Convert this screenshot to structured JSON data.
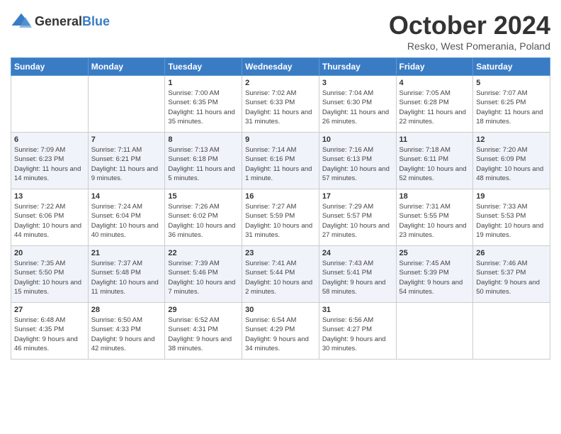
{
  "logo": {
    "general": "General",
    "blue": "Blue"
  },
  "title": "October 2024",
  "location": "Resko, West Pomerania, Poland",
  "weekdays": [
    "Sunday",
    "Monday",
    "Tuesday",
    "Wednesday",
    "Thursday",
    "Friday",
    "Saturday"
  ],
  "weeks": [
    [
      {
        "day": "",
        "sunrise": "",
        "sunset": "",
        "daylight": ""
      },
      {
        "day": "",
        "sunrise": "",
        "sunset": "",
        "daylight": ""
      },
      {
        "day": "1",
        "sunrise": "Sunrise: 7:00 AM",
        "sunset": "Sunset: 6:35 PM",
        "daylight": "Daylight: 11 hours and 35 minutes."
      },
      {
        "day": "2",
        "sunrise": "Sunrise: 7:02 AM",
        "sunset": "Sunset: 6:33 PM",
        "daylight": "Daylight: 11 hours and 31 minutes."
      },
      {
        "day": "3",
        "sunrise": "Sunrise: 7:04 AM",
        "sunset": "Sunset: 6:30 PM",
        "daylight": "Daylight: 11 hours and 26 minutes."
      },
      {
        "day": "4",
        "sunrise": "Sunrise: 7:05 AM",
        "sunset": "Sunset: 6:28 PM",
        "daylight": "Daylight: 11 hours and 22 minutes."
      },
      {
        "day": "5",
        "sunrise": "Sunrise: 7:07 AM",
        "sunset": "Sunset: 6:25 PM",
        "daylight": "Daylight: 11 hours and 18 minutes."
      }
    ],
    [
      {
        "day": "6",
        "sunrise": "Sunrise: 7:09 AM",
        "sunset": "Sunset: 6:23 PM",
        "daylight": "Daylight: 11 hours and 14 minutes."
      },
      {
        "day": "7",
        "sunrise": "Sunrise: 7:11 AM",
        "sunset": "Sunset: 6:21 PM",
        "daylight": "Daylight: 11 hours and 9 minutes."
      },
      {
        "day": "8",
        "sunrise": "Sunrise: 7:13 AM",
        "sunset": "Sunset: 6:18 PM",
        "daylight": "Daylight: 11 hours and 5 minutes."
      },
      {
        "day": "9",
        "sunrise": "Sunrise: 7:14 AM",
        "sunset": "Sunset: 6:16 PM",
        "daylight": "Daylight: 11 hours and 1 minute."
      },
      {
        "day": "10",
        "sunrise": "Sunrise: 7:16 AM",
        "sunset": "Sunset: 6:13 PM",
        "daylight": "Daylight: 10 hours and 57 minutes."
      },
      {
        "day": "11",
        "sunrise": "Sunrise: 7:18 AM",
        "sunset": "Sunset: 6:11 PM",
        "daylight": "Daylight: 10 hours and 52 minutes."
      },
      {
        "day": "12",
        "sunrise": "Sunrise: 7:20 AM",
        "sunset": "Sunset: 6:09 PM",
        "daylight": "Daylight: 10 hours and 48 minutes."
      }
    ],
    [
      {
        "day": "13",
        "sunrise": "Sunrise: 7:22 AM",
        "sunset": "Sunset: 6:06 PM",
        "daylight": "Daylight: 10 hours and 44 minutes."
      },
      {
        "day": "14",
        "sunrise": "Sunrise: 7:24 AM",
        "sunset": "Sunset: 6:04 PM",
        "daylight": "Daylight: 10 hours and 40 minutes."
      },
      {
        "day": "15",
        "sunrise": "Sunrise: 7:26 AM",
        "sunset": "Sunset: 6:02 PM",
        "daylight": "Daylight: 10 hours and 36 minutes."
      },
      {
        "day": "16",
        "sunrise": "Sunrise: 7:27 AM",
        "sunset": "Sunset: 5:59 PM",
        "daylight": "Daylight: 10 hours and 31 minutes."
      },
      {
        "day": "17",
        "sunrise": "Sunrise: 7:29 AM",
        "sunset": "Sunset: 5:57 PM",
        "daylight": "Daylight: 10 hours and 27 minutes."
      },
      {
        "day": "18",
        "sunrise": "Sunrise: 7:31 AM",
        "sunset": "Sunset: 5:55 PM",
        "daylight": "Daylight: 10 hours and 23 minutes."
      },
      {
        "day": "19",
        "sunrise": "Sunrise: 7:33 AM",
        "sunset": "Sunset: 5:53 PM",
        "daylight": "Daylight: 10 hours and 19 minutes."
      }
    ],
    [
      {
        "day": "20",
        "sunrise": "Sunrise: 7:35 AM",
        "sunset": "Sunset: 5:50 PM",
        "daylight": "Daylight: 10 hours and 15 minutes."
      },
      {
        "day": "21",
        "sunrise": "Sunrise: 7:37 AM",
        "sunset": "Sunset: 5:48 PM",
        "daylight": "Daylight: 10 hours and 11 minutes."
      },
      {
        "day": "22",
        "sunrise": "Sunrise: 7:39 AM",
        "sunset": "Sunset: 5:46 PM",
        "daylight": "Daylight: 10 hours and 7 minutes."
      },
      {
        "day": "23",
        "sunrise": "Sunrise: 7:41 AM",
        "sunset": "Sunset: 5:44 PM",
        "daylight": "Daylight: 10 hours and 2 minutes."
      },
      {
        "day": "24",
        "sunrise": "Sunrise: 7:43 AM",
        "sunset": "Sunset: 5:41 PM",
        "daylight": "Daylight: 9 hours and 58 minutes."
      },
      {
        "day": "25",
        "sunrise": "Sunrise: 7:45 AM",
        "sunset": "Sunset: 5:39 PM",
        "daylight": "Daylight: 9 hours and 54 minutes."
      },
      {
        "day": "26",
        "sunrise": "Sunrise: 7:46 AM",
        "sunset": "Sunset: 5:37 PM",
        "daylight": "Daylight: 9 hours and 50 minutes."
      }
    ],
    [
      {
        "day": "27",
        "sunrise": "Sunrise: 6:48 AM",
        "sunset": "Sunset: 4:35 PM",
        "daylight": "Daylight: 9 hours and 46 minutes."
      },
      {
        "day": "28",
        "sunrise": "Sunrise: 6:50 AM",
        "sunset": "Sunset: 4:33 PM",
        "daylight": "Daylight: 9 hours and 42 minutes."
      },
      {
        "day": "29",
        "sunrise": "Sunrise: 6:52 AM",
        "sunset": "Sunset: 4:31 PM",
        "daylight": "Daylight: 9 hours and 38 minutes."
      },
      {
        "day": "30",
        "sunrise": "Sunrise: 6:54 AM",
        "sunset": "Sunset: 4:29 PM",
        "daylight": "Daylight: 9 hours and 34 minutes."
      },
      {
        "day": "31",
        "sunrise": "Sunrise: 6:56 AM",
        "sunset": "Sunset: 4:27 PM",
        "daylight": "Daylight: 9 hours and 30 minutes."
      },
      {
        "day": "",
        "sunrise": "",
        "sunset": "",
        "daylight": ""
      },
      {
        "day": "",
        "sunrise": "",
        "sunset": "",
        "daylight": ""
      }
    ]
  ]
}
